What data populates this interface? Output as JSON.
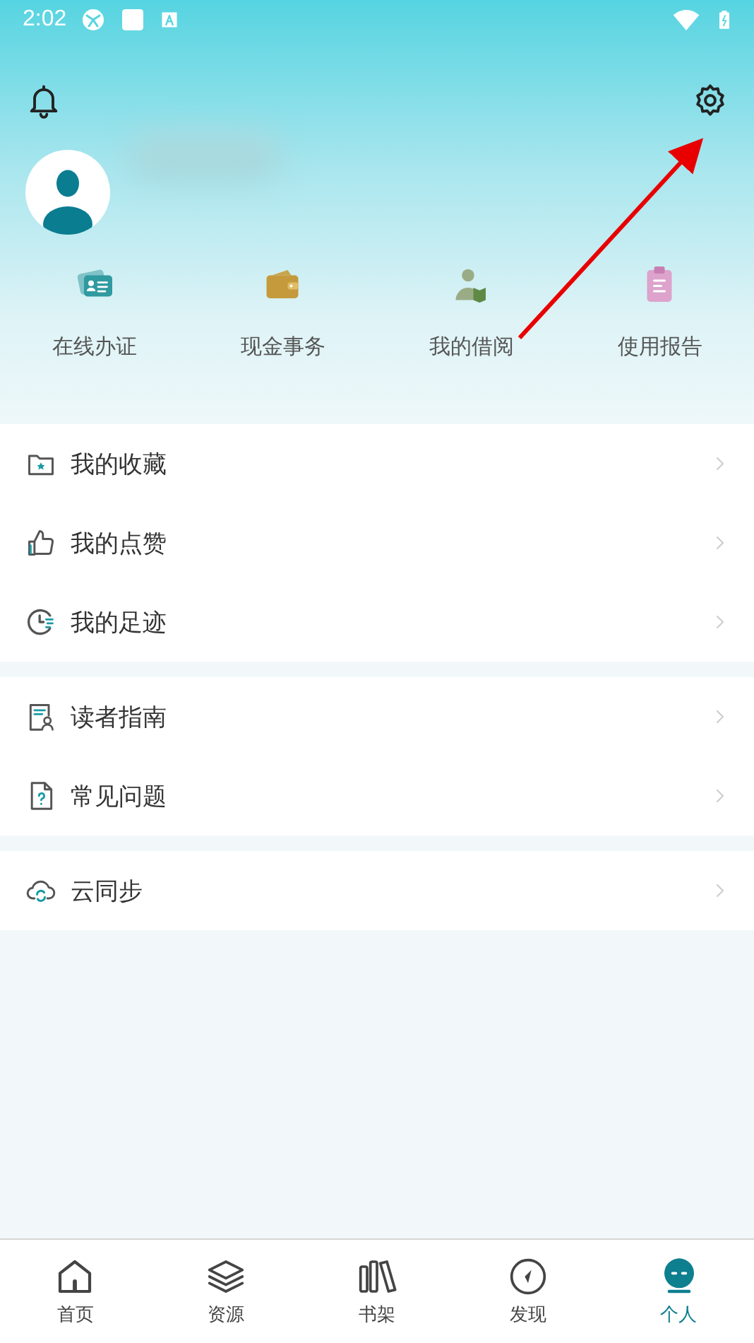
{
  "status_bar": {
    "time": "2:02"
  },
  "quick_actions": [
    {
      "label": "在线办证",
      "kind": "card"
    },
    {
      "label": "现金事务",
      "kind": "wallet"
    },
    {
      "label": "我的借阅",
      "kind": "reader"
    },
    {
      "label": "使用报告",
      "kind": "report"
    }
  ],
  "menu_groups": [
    [
      {
        "label": "我的收藏",
        "kind": "favorites"
      },
      {
        "label": "我的点赞",
        "kind": "likes"
      },
      {
        "label": "我的足迹",
        "kind": "history"
      }
    ],
    [
      {
        "label": "读者指南",
        "kind": "guide"
      },
      {
        "label": "常见问题",
        "kind": "faq"
      }
    ],
    [
      {
        "label": "云同步",
        "kind": "sync"
      }
    ]
  ],
  "bottom_nav": [
    {
      "label": "首页",
      "kind": "home",
      "selected": false
    },
    {
      "label": "资源",
      "kind": "layers",
      "selected": false
    },
    {
      "label": "书架",
      "kind": "shelf",
      "selected": false
    },
    {
      "label": "发现",
      "kind": "compass",
      "selected": false
    },
    {
      "label": "个人",
      "kind": "person",
      "selected": true
    }
  ]
}
